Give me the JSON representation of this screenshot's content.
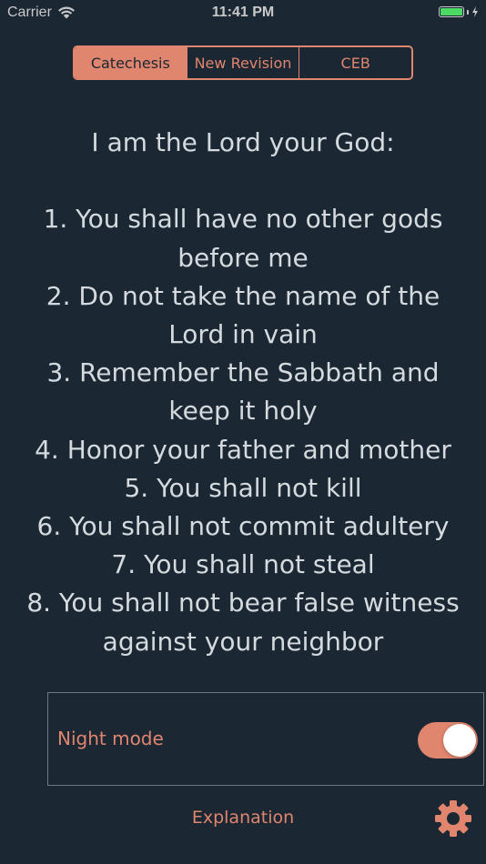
{
  "status_bar": {
    "carrier": "Carrier",
    "time": "11:41 PM",
    "icons": [
      "wifi-icon",
      "battery-icon",
      "charging-bolt-icon"
    ]
  },
  "segments": [
    {
      "label": "Catechesis",
      "selected": true
    },
    {
      "label": "New Revision",
      "selected": false
    },
    {
      "label": "CEB",
      "selected": false
    }
  ],
  "content": {
    "heading": "I am the Lord your God:",
    "commandments": [
      "1. You shall have no other gods before me",
      "2. Do not take the name of the Lord in vain",
      "3. Remember the Sabbath and keep it holy",
      "4. Honor your father and mother",
      "5. You shall not kill",
      "6. You shall not commit adultery",
      "7. You shall not steal",
      "8. You shall not bear false witness against your neighbor"
    ]
  },
  "night_mode": {
    "label": "Night mode",
    "on": true
  },
  "footer": {
    "explanation_label": "Explanation",
    "settings_icon": "gear-icon"
  },
  "colors": {
    "background": "#1b2733",
    "accent": "#e0856e",
    "text": "#d4dade",
    "panel_border": "#6b7a85"
  }
}
